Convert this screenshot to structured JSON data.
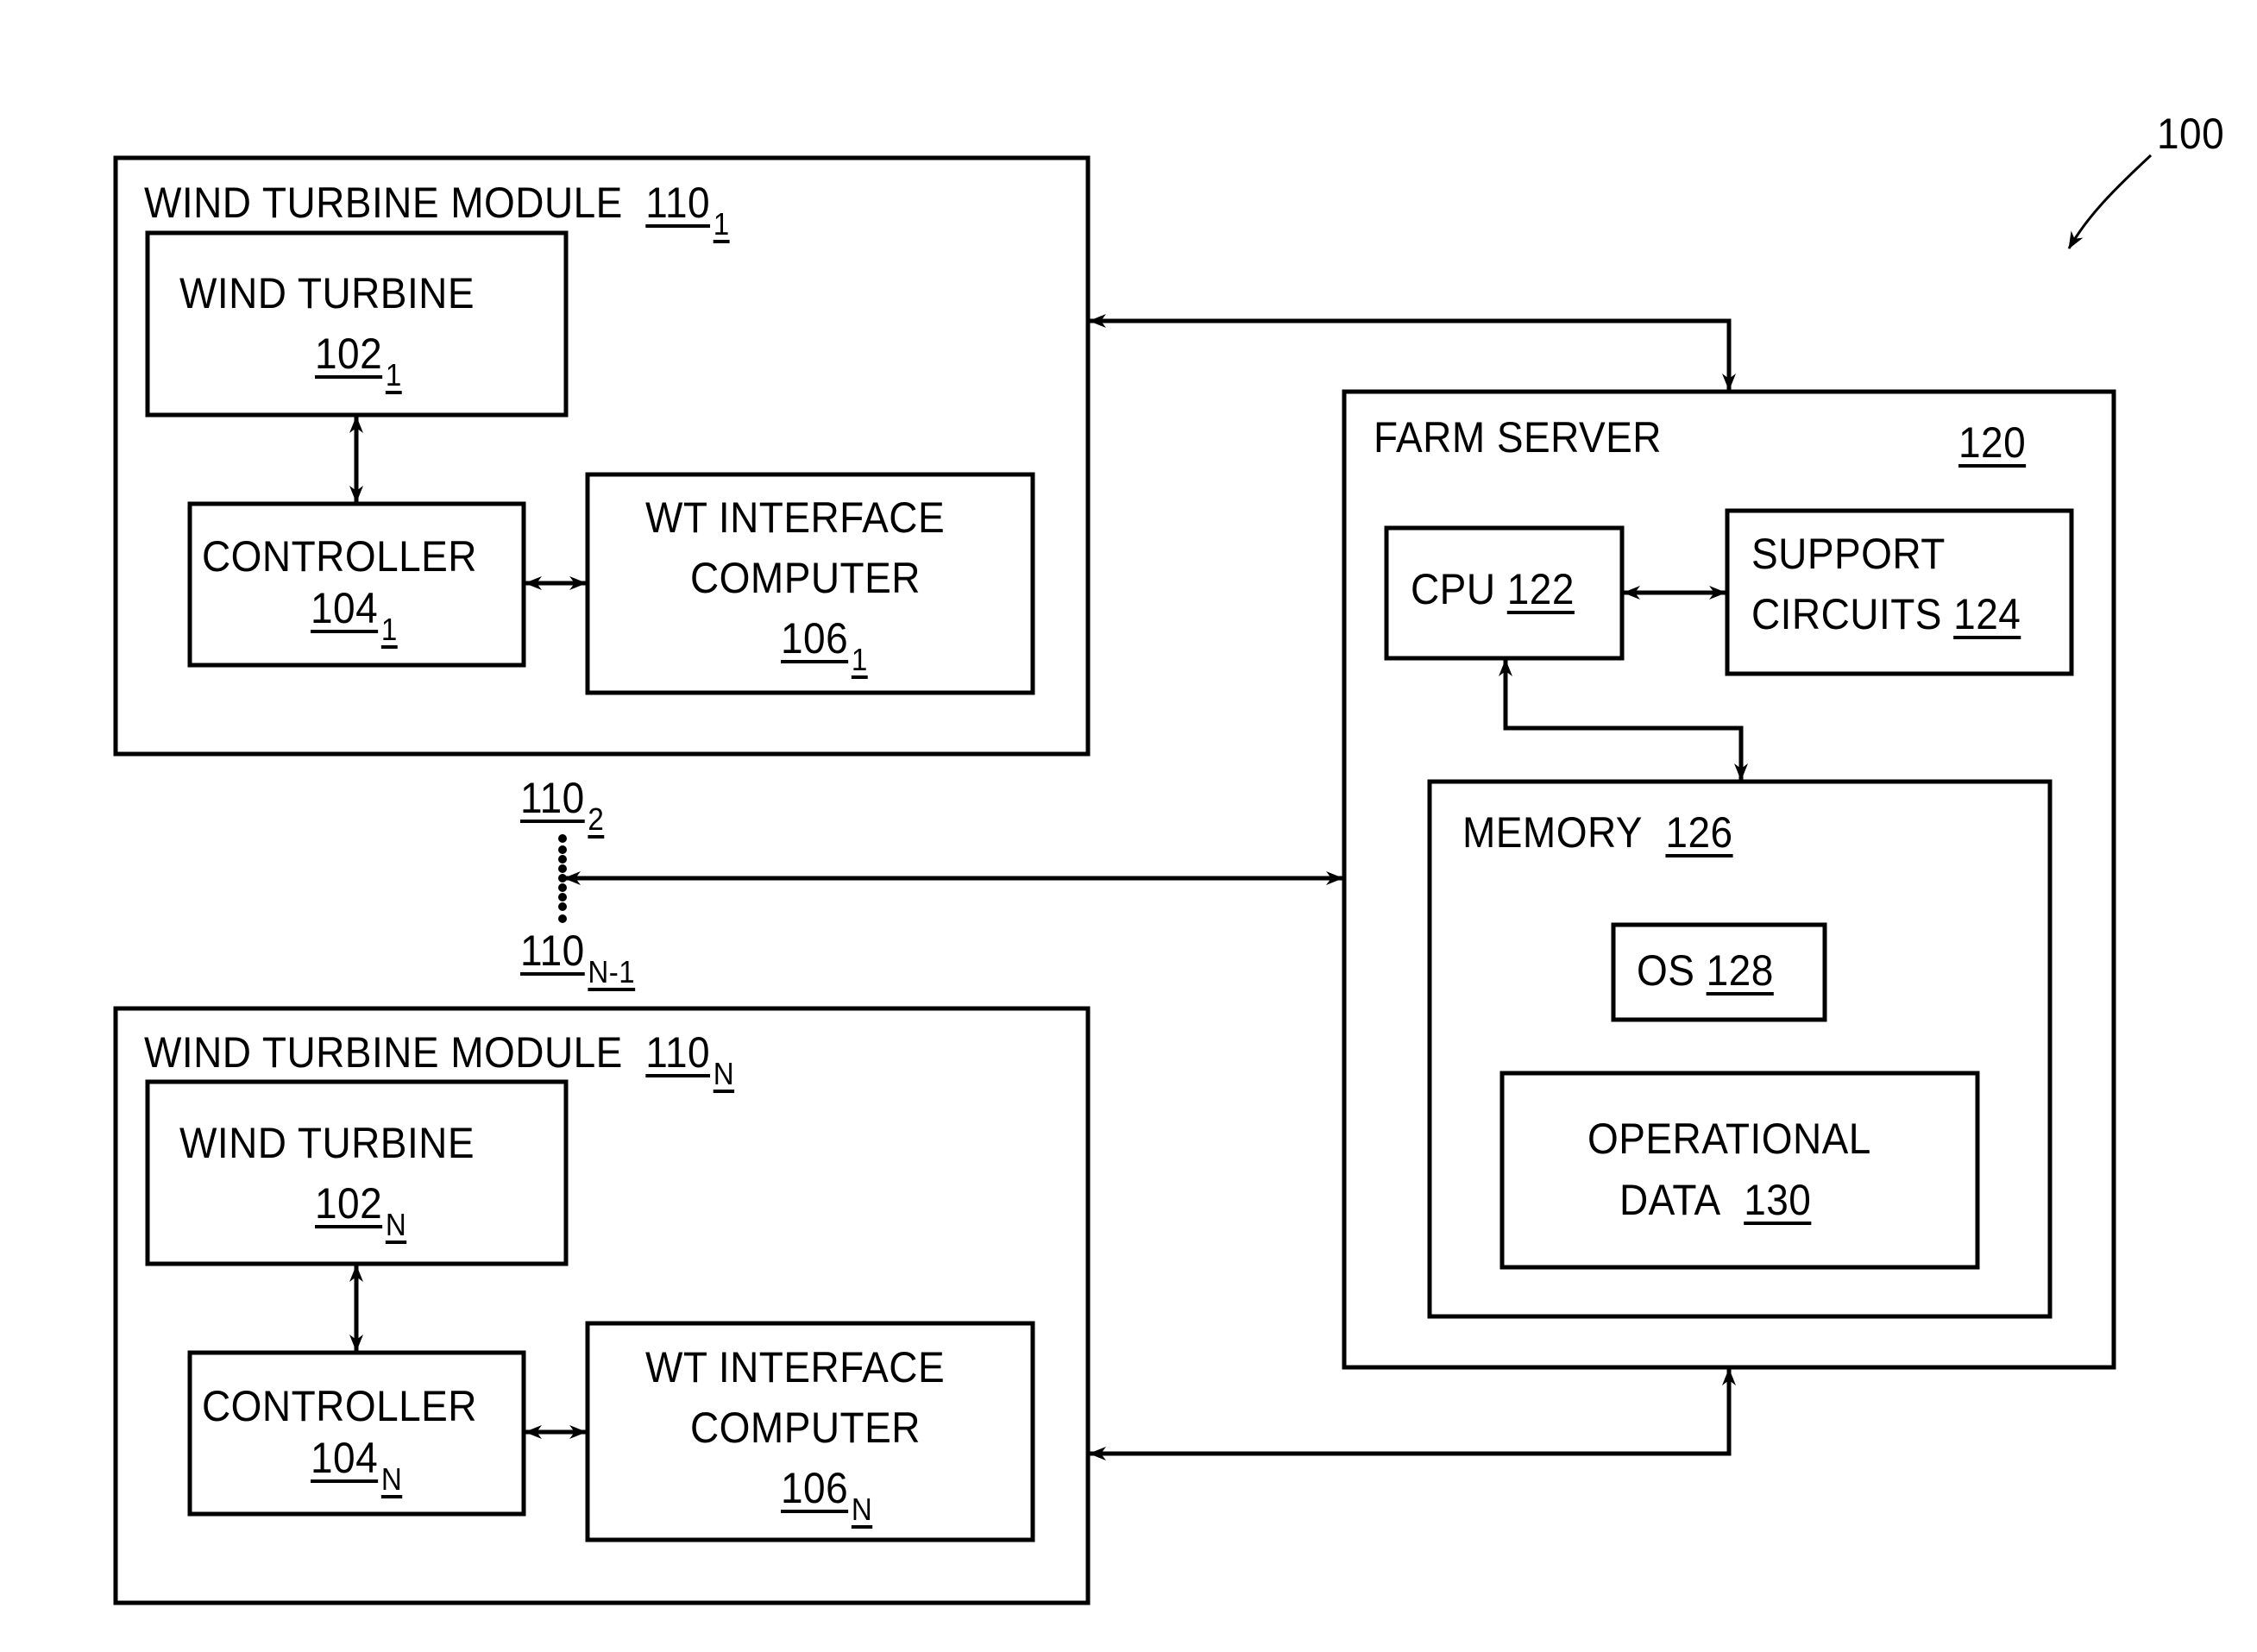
{
  "figure": {
    "ref_label": "100",
    "farm_server": {
      "title": "FARM SERVER",
      "ref": "120",
      "cpu": {
        "label": "CPU",
        "ref": "122"
      },
      "support_circuits": {
        "line1": "SUPPORT",
        "line2": "CIRCUITS",
        "ref": "124"
      },
      "memory": {
        "label": "MEMORY",
        "ref": "126",
        "os": {
          "label": "OS",
          "ref": "128"
        },
        "operational_data": {
          "line1": "OPERATIONAL",
          "line2": "DATA",
          "ref": "130"
        }
      }
    },
    "modules": [
      {
        "title": "WIND TURBINE MODULE",
        "ref": "110",
        "sub": "1",
        "wind_turbine": {
          "label": "WIND TURBINE",
          "ref": "102",
          "sub": "1"
        },
        "controller": {
          "label": "CONTROLLER",
          "ref": "104",
          "sub": "1"
        },
        "interface": {
          "line1": "WT INTERFACE",
          "line2": "COMPUTER",
          "ref": "106",
          "sub": "1"
        }
      },
      {
        "title": "WIND TURBINE MODULE",
        "ref": "110",
        "sub": "N",
        "wind_turbine": {
          "label": "WIND TURBINE",
          "ref": "102",
          "sub": "N"
        },
        "controller": {
          "label": "CONTROLLER",
          "ref": "104",
          "sub": "N"
        },
        "interface": {
          "line1": "WT INTERFACE",
          "line2": "COMPUTER",
          "ref": "106",
          "sub": "N"
        }
      }
    ],
    "intermediate_modules": {
      "first": {
        "ref": "110",
        "sub": "2"
      },
      "last": {
        "ref": "110",
        "sub": "N-1"
      }
    }
  }
}
